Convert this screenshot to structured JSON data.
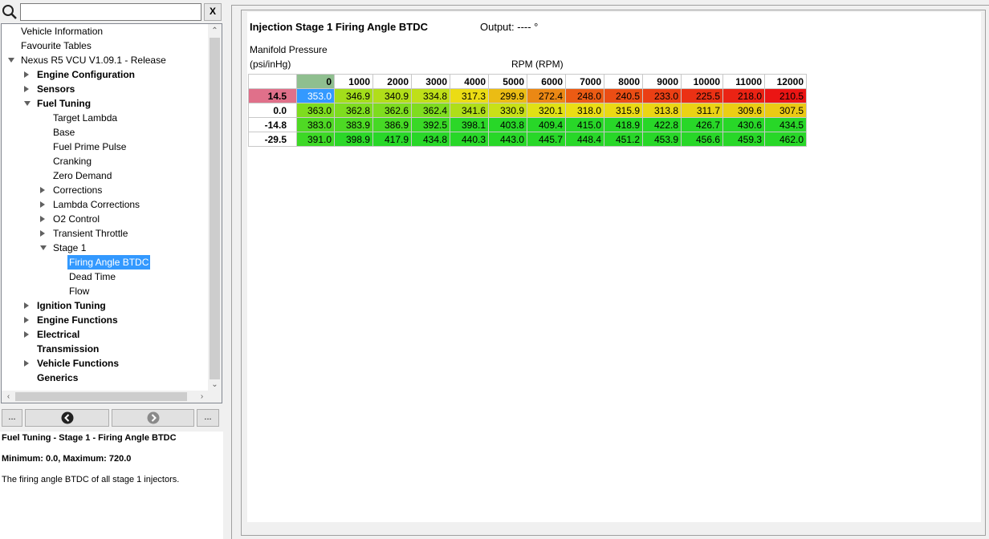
{
  "search": {
    "value": "",
    "placeholder": "",
    "clear_label": "X"
  },
  "tree": {
    "items": [
      {
        "label": "Vehicle Information",
        "bold": false,
        "indent": 0,
        "arrow": "none"
      },
      {
        "label": "Favourite Tables",
        "bold": false,
        "indent": 0,
        "arrow": "none"
      },
      {
        "label": "Nexus R5 VCU V1.09.1 - Release",
        "bold": false,
        "indent": 0,
        "arrow": "down"
      },
      {
        "label": "Engine Configuration",
        "bold": true,
        "indent": 1,
        "arrow": "right"
      },
      {
        "label": "Sensors",
        "bold": true,
        "indent": 1,
        "arrow": "right"
      },
      {
        "label": "Fuel Tuning",
        "bold": true,
        "indent": 1,
        "arrow": "down"
      },
      {
        "label": "Target Lambda",
        "bold": false,
        "indent": 2,
        "arrow": "none"
      },
      {
        "label": "Base",
        "bold": false,
        "indent": 2,
        "arrow": "none"
      },
      {
        "label": "Fuel Prime Pulse",
        "bold": false,
        "indent": 2,
        "arrow": "none"
      },
      {
        "label": "Cranking",
        "bold": false,
        "indent": 2,
        "arrow": "none"
      },
      {
        "label": "Zero Demand",
        "bold": false,
        "indent": 2,
        "arrow": "none"
      },
      {
        "label": "Corrections",
        "bold": false,
        "indent": 2,
        "arrow": "right"
      },
      {
        "label": "Lambda Corrections",
        "bold": false,
        "indent": 2,
        "arrow": "right"
      },
      {
        "label": "O2 Control",
        "bold": false,
        "indent": 2,
        "arrow": "right"
      },
      {
        "label": "Transient Throttle",
        "bold": false,
        "indent": 2,
        "arrow": "right"
      },
      {
        "label": "Stage 1",
        "bold": false,
        "indent": 2,
        "arrow": "down"
      },
      {
        "label": "Firing Angle BTDC",
        "bold": false,
        "indent": 3,
        "arrow": "none",
        "selected": true
      },
      {
        "label": "Dead Time",
        "bold": false,
        "indent": 3,
        "arrow": "none"
      },
      {
        "label": "Flow",
        "bold": false,
        "indent": 3,
        "arrow": "none"
      },
      {
        "label": "Ignition Tuning",
        "bold": true,
        "indent": 1,
        "arrow": "right"
      },
      {
        "label": "Engine Functions",
        "bold": true,
        "indent": 1,
        "arrow": "right"
      },
      {
        "label": "Electrical",
        "bold": true,
        "indent": 1,
        "arrow": "right"
      },
      {
        "label": "Transmission",
        "bold": true,
        "indent": 1,
        "arrow": "none"
      },
      {
        "label": "Vehicle Functions",
        "bold": true,
        "indent": 1,
        "arrow": "right"
      },
      {
        "label": "Generics",
        "bold": true,
        "indent": 1,
        "arrow": "none"
      }
    ]
  },
  "nav": {
    "more_left": "...",
    "more_right": "..."
  },
  "info": {
    "path": "Fuel Tuning - Stage 1 - Firing Angle BTDC",
    "range": "Minimum: 0.0, Maximum: 720.0",
    "description": "The firing angle BTDC of all stage 1 injectors."
  },
  "table": {
    "title": "Injection Stage 1 Firing Angle BTDC",
    "output": "Output: ---- °",
    "y_label_line1": "Manifold Pressure",
    "y_label_line2": "(psi/inHg)",
    "x_label": "RPM (RPM)",
    "columns": [
      "0",
      "1000",
      "2000",
      "3000",
      "4000",
      "5000",
      "6000",
      "7000",
      "8000",
      "9000",
      "10000",
      "11000",
      "12000"
    ],
    "rows": [
      {
        "label": "14.5",
        "values": [
          "353.0",
          "346.9",
          "340.9",
          "334.8",
          "317.3",
          "299.9",
          "272.4",
          "248.0",
          "240.5",
          "233.0",
          "225.5",
          "218.0",
          "210.5"
        ]
      },
      {
        "label": "0.0",
        "values": [
          "363.0",
          "362.8",
          "362.6",
          "362.4",
          "341.6",
          "330.9",
          "320.1",
          "318.0",
          "315.9",
          "313.8",
          "311.7",
          "309.6",
          "307.5"
        ]
      },
      {
        "label": "-14.8",
        "values": [
          "383.0",
          "383.9",
          "386.9",
          "392.5",
          "398.1",
          "403.8",
          "409.4",
          "415.0",
          "418.9",
          "422.8",
          "426.7",
          "430.6",
          "434.5"
        ]
      },
      {
        "label": "-29.5",
        "values": [
          "391.0",
          "398.9",
          "417.9",
          "434.8",
          "440.3",
          "443.0",
          "445.7",
          "448.4",
          "451.2",
          "453.9",
          "456.6",
          "459.3",
          "462.0"
        ]
      }
    ],
    "colors": {
      "active_row_header": "#e0708a",
      "active_col_header": "#8fbf8f",
      "selected_cell": "#3399ff"
    }
  }
}
